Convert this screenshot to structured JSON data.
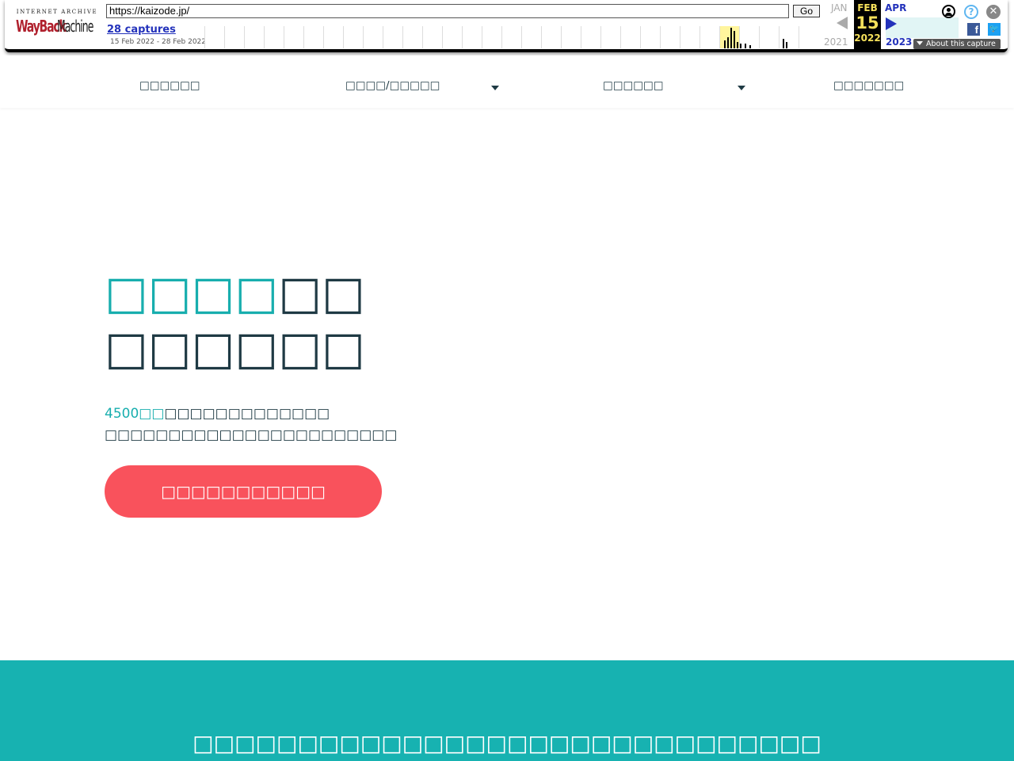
{
  "wayback": {
    "logo_top": "INTERNET ARCHIVE",
    "logo_way": "WayBack",
    "logo_machine": "Machine",
    "url": "https://kaizode.jp/",
    "go_label": "Go",
    "captures_link": "28 captures",
    "date_range": "15 Feb 2022 - 28 Feb 2022",
    "prev_month": "JAN",
    "current_month": "FEB",
    "current_day": "15",
    "current_year": "2022",
    "next_month": "APR",
    "prev_year": "2021",
    "next_year": "2023",
    "about_label": "About this capture",
    "help_glyph": "?",
    "close_glyph": "✕",
    "facebook_glyph": "f",
    "twitter_glyph": "🐦",
    "icons": [
      "user-icon",
      "help-icon",
      "close-icon",
      "facebook-icon",
      "twitter-icon"
    ]
  },
  "nav": {
    "items": [
      {
        "label": "□□□□□□",
        "has_dropdown": false
      },
      {
        "label": "□□□□/□□□□□",
        "has_dropdown": true
      },
      {
        "label": "□□□□□□",
        "has_dropdown": true
      },
      {
        "label": "□□□□□□□",
        "has_dropdown": false
      }
    ]
  },
  "hero": {
    "title_accent": "□□□□",
    "title_rest_line1": "□□",
    "title_line2": "□□□□□□",
    "sub_accent_num": "4500",
    "sub_accent_unit": "□□",
    "sub_line1_rest": "□□□□□□□□□□□□□",
    "sub_line2": "□□□□□□□□□□□□□□□□□□□□□□□",
    "cta_label": "□□□□□□□□□□□"
  },
  "band": {
    "text": "□□□□□□□□□□□□□□□□□□□□□□□□□□□□□□"
  },
  "colors": {
    "accent": "#18aeae",
    "cta": "#f9525c",
    "text": "#1f3a44",
    "band": "#17b2b1"
  }
}
